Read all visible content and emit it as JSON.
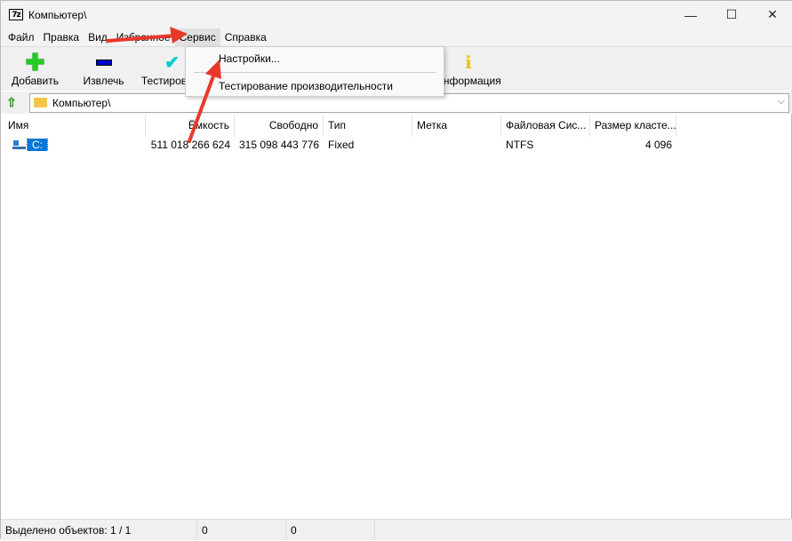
{
  "window": {
    "title": "Компьютер\\",
    "logo": "7z",
    "minimize": "—",
    "maximize": "☐",
    "close": "✕"
  },
  "menu": [
    "Файл",
    "Правка",
    "Вид",
    "Избранное",
    "Сервис",
    "Справка"
  ],
  "toolbar": [
    {
      "label": "Добавить",
      "icon": "plus-icon",
      "color": "#22cc22"
    },
    {
      "label": "Извлечь",
      "icon": "minus-icon",
      "color": "#0000cc"
    },
    {
      "label": "Тестировать",
      "icon": "check-icon",
      "color": "#00cccc"
    },
    {
      "label": "Информация",
      "icon": "info-icon",
      "color": "#e6c800"
    }
  ],
  "address": {
    "path": "Компьютер\\"
  },
  "columns": [
    "Имя",
    "Ёмкость",
    "Свободно",
    "Тип",
    "Метка",
    "Файловая Сис...",
    "Размер класте..."
  ],
  "rows": [
    {
      "name": "C:",
      "capacity": "511 018 266 624",
      "free": "315 098 443 776",
      "type": "Fixed",
      "label": "",
      "fs": "NTFS",
      "cluster": "4 096"
    }
  ],
  "dropdown": {
    "items": [
      "Настройки...",
      "Тестирование производительности"
    ]
  },
  "status": {
    "selected": "Выделено объектов: 1 / 1",
    "size": "0",
    "packed": "0"
  },
  "annotation_color": "#e8392b"
}
